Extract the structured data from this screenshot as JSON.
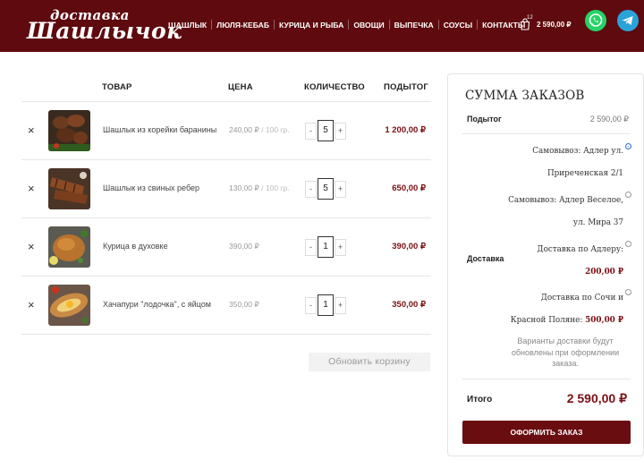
{
  "logo": {
    "top_text": "доставка",
    "bottom_text": "Шашлычок"
  },
  "nav": [
    "ШАШЛЫК",
    "ЛЮЛЯ-КЕБАБ",
    "КУРИЦА И РЫБА",
    "ОВОЩИ",
    "ВЫПЕЧКА",
    "СОУСЫ",
    "КОНТАКТЫ"
  ],
  "cart": {
    "count": "12",
    "total": "2 590,00 ₽"
  },
  "icons": {
    "cart": "shopping-bag-icon",
    "whatsapp": "whatsapp-icon",
    "telegram": "telegram-icon",
    "remove": "close-icon"
  },
  "table": {
    "headers": {
      "product": "ТОВАР",
      "price": "ЦЕНА",
      "quantity": "КОЛИЧЕСТВО",
      "subtotal": "ПОДЫТОГ"
    },
    "rows": [
      {
        "name": "Шашлык из корейки баранины",
        "price": "240,00 ₽",
        "unit": " / 100 гр.",
        "qty": "5",
        "subtotal": "1 200,00 ₽"
      },
      {
        "name": "Шашлык из свиных ребер",
        "price": "130,00 ₽",
        "unit": " / 100 гр.",
        "qty": "5",
        "subtotal": "650,00 ₽"
      },
      {
        "name": "Курица в духовке",
        "price": "390,00 ₽",
        "unit": "",
        "qty": "1",
        "subtotal": "390,00 ₽"
      },
      {
        "name": "Хачапури \"лодочка\", с яйцом",
        "price": "350,00 ₽",
        "unit": "",
        "qty": "1",
        "subtotal": "350,00 ₽"
      }
    ],
    "minus": "-",
    "plus": "+",
    "remove_glyph": "×",
    "update_button": "Обновить корзину"
  },
  "summary": {
    "title": "СУММА ЗАКАЗОВ",
    "subtotal_label": "Подытог",
    "subtotal_value": "2 590,00 ₽",
    "shipping_label": "Доставка",
    "shipping_options": [
      {
        "text": "Самовывоз: Адлер ул. Приреченская 2/1",
        "price": "",
        "selected": true
      },
      {
        "text": "Самовывоз: Адлер Веселое, ул. Мира 37",
        "price": "",
        "selected": false
      },
      {
        "text": "Доставка по Адлеру:",
        "price": "200,00 ₽",
        "selected": false
      },
      {
        "text": "Доставка по Сочи и Красной Поляне:",
        "price": "500,00 ₽",
        "selected": false
      }
    ],
    "shipping_note": "Варианты доставки будут обновлены при оформлении заказа.",
    "total_label": "Итого",
    "total_value": "2 590,00 ₽",
    "checkout_button": "ОФОРМИТЬ ЗАКАЗ"
  },
  "colors": {
    "brand": "#5e0a0e",
    "accent_price": "#7a0f12",
    "button": "#6a0d11",
    "whatsapp": "#25d366",
    "telegram": "#2aa3d9"
  }
}
